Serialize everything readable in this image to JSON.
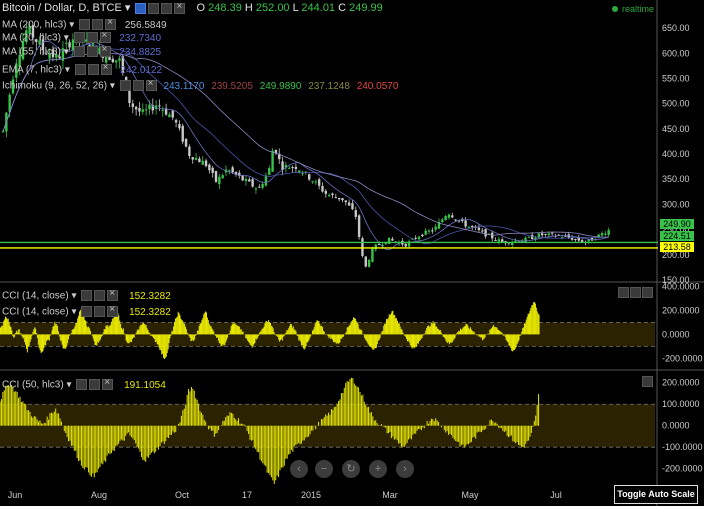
{
  "header": {
    "symbol": "Bitcoin / Dollar, D, BTCE",
    "ohlc": {
      "o_label": "O",
      "o": "248.39",
      "h_label": "H",
      "h": "252.00",
      "l_label": "L",
      "l": "244.01",
      "c_label": "C",
      "c": "249.99"
    },
    "realtime": "realtime"
  },
  "overlays": [
    {
      "label": "MA (200, hlc3)",
      "value": "256.5849",
      "color": "#c8c8c8"
    },
    {
      "label": "MA (20, hlc3)",
      "value": "232.7340",
      "color": "#5d6dd0"
    },
    {
      "label": "MA (55, hlc3)",
      "value": "234.8825",
      "color": "#5d6dd0"
    },
    {
      "label": "EMA (7, hlc3)",
      "value": "242.0122",
      "color": "#5d6dd0"
    },
    {
      "label": "Ichimoku (9, 26, 52, 26)",
      "values": [
        "243.1170",
        "239.5205",
        "249.9890",
        "237.1248",
        "240.0570"
      ],
      "colors": [
        "#4a8fe0",
        "#a04040",
        "#39c24a",
        "#8a8a40",
        "#e04a3a"
      ]
    }
  ],
  "indicators": [
    {
      "label": "CCI (14, close)",
      "value": "152.3282"
    },
    {
      "label": "CCI (14, close)",
      "value": "152.3282"
    },
    {
      "label": "CCI (50, hlc3)",
      "value": "191.1054"
    }
  ],
  "price_tags": [
    {
      "value": "249.90",
      "bg": "#39c24a"
    },
    {
      "value": "224.51",
      "bg": "#39c24a"
    },
    {
      "value": "213.58",
      "bg": "#ffff00"
    }
  ],
  "toggle_label": "Toggle Auto Scale",
  "colors": {
    "up": "#39c24a",
    "down": "#c8c8c8",
    "cci": "#e8e800",
    "hline_green": "#39c24a",
    "hline_yellow": "#ffff00",
    "band": "#2a2200"
  },
  "chart_data": {
    "type": "line",
    "main": {
      "ylim": [
        150,
        680
      ],
      "y_ticks": [
        150,
        200,
        250,
        300,
        350,
        400,
        450,
        500,
        550,
        600,
        650
      ],
      "tick_labels": [
        "150.00",
        "200.00",
        "250.00",
        "300.00",
        "350.00",
        "400.00",
        "450.00",
        "500.00",
        "550.00",
        "600.00",
        "650.00"
      ],
      "hlines": [
        224.51,
        213.58
      ],
      "x_labels": [
        "Jun",
        "Aug",
        "Oct",
        "17",
        "2015",
        "Mar",
        "May",
        "Jul"
      ],
      "close": [
        [
          "2014-05-20",
          445
        ],
        [
          "2014-05-28",
          580
        ],
        [
          "2014-06-05",
          650
        ],
        [
          "2014-06-15",
          610
        ],
        [
          "2014-06-25",
          590
        ],
        [
          "2014-07-05",
          630
        ],
        [
          "2014-07-15",
          620
        ],
        [
          "2014-07-25",
          600
        ],
        [
          "2014-08-05",
          585
        ],
        [
          "2014-08-12",
          500
        ],
        [
          "2014-08-20",
          480
        ],
        [
          "2014-08-30",
          500
        ],
        [
          "2014-09-10",
          470
        ],
        [
          "2014-09-20",
          400
        ],
        [
          "2014-10-01",
          380
        ],
        [
          "2014-10-08",
          345
        ],
        [
          "2014-10-15",
          370
        ],
        [
          "2014-10-25",
          350
        ],
        [
          "2014-11-05",
          330
        ],
        [
          "2014-11-12",
          370
        ],
        [
          "2014-11-15",
          420
        ],
        [
          "2014-11-20",
          375
        ],
        [
          "2014-11-30",
          375
        ],
        [
          "2014-12-10",
          350
        ],
        [
          "2014-12-20",
          320
        ],
        [
          "2014-12-31",
          310
        ],
        [
          "2015-01-08",
          280
        ],
        [
          "2015-01-14",
          170
        ],
        [
          "2015-01-20",
          215
        ],
        [
          "2015-01-30",
          230
        ],
        [
          "2015-02-10",
          220
        ],
        [
          "2015-02-20",
          240
        ],
        [
          "2015-03-01",
          250
        ],
        [
          "2015-03-10",
          285
        ],
        [
          "2015-03-20",
          262
        ],
        [
          "2015-04-01",
          245
        ],
        [
          "2015-04-15",
          225
        ],
        [
          "2015-04-30",
          230
        ],
        [
          "2015-05-10",
          240
        ],
        [
          "2015-05-25",
          237
        ],
        [
          "2015-06-10",
          225
        ],
        [
          "2015-06-20",
          242
        ],
        [
          "2015-06-25",
          249.99
        ]
      ]
    },
    "cci1": {
      "ylim": [
        -280,
        420
      ],
      "y_ticks": [
        -200,
        0,
        200,
        400
      ],
      "tick_labels": [
        "-200.0000",
        "0.0000",
        "200.0000",
        "400.0000"
      ],
      "bands": [
        -100,
        100
      ]
    },
    "cci2": {
      "ylim": [
        -290,
        250
      ],
      "y_ticks": [
        -200,
        -100,
        0,
        100,
        200
      ],
      "tick_labels": [
        "-200.0000",
        "-100.0000",
        "0.0000",
        "100.0000",
        "200.0000"
      ],
      "bands": [
        -100,
        100
      ]
    },
    "cci14": [
      60,
      80,
      160,
      120,
      60,
      -40,
      20,
      40,
      -20,
      -60,
      -140,
      -60,
      20,
      60,
      -80,
      -160,
      -120,
      -60,
      -40,
      40,
      100,
      60,
      -40,
      -120,
      -120,
      -40,
      20,
      60,
      100,
      180,
      220,
      120,
      60,
      40,
      -40,
      -100,
      -60,
      -20,
      40,
      80,
      60,
      120,
      160,
      180,
      80,
      40,
      -40,
      -80,
      -60,
      -20,
      20,
      60,
      100,
      80,
      40,
      0,
      -40,
      -60,
      -100,
      -160,
      -200,
      -160,
      -40,
      40,
      120,
      180,
      140,
      100,
      40,
      -20,
      -60,
      -40,
      20,
      80,
      140,
      200,
      120,
      60,
      20,
      -20,
      -60,
      -100,
      -80,
      -20,
      40,
      100,
      80,
      60,
      40,
      0,
      -40,
      -80,
      -100,
      -60,
      -20,
      20,
      60,
      100,
      120,
      80,
      20,
      -20,
      -60,
      -40,
      0,
      40,
      80,
      60,
      20,
      -40,
      -80,
      -120,
      -80,
      -40,
      20,
      80,
      120,
      80,
      40,
      0,
      -20,
      -40,
      -60,
      -80,
      -60,
      -20,
      20,
      60,
      100,
      140,
      120,
      60,
      20,
      -20,
      -60,
      -100,
      -140,
      -120,
      -60,
      0,
      60,
      120,
      160,
      200,
      160,
      120,
      60,
      20,
      -20,
      -60,
      -100,
      -120,
      -100,
      -60,
      -20,
      20,
      60,
      80,
      100,
      80,
      40,
      20,
      -20,
      -60,
      -80,
      -60,
      -20,
      20,
      40,
      60,
      80,
      60,
      40,
      20,
      0,
      -20,
      -40,
      -20,
      0,
      40,
      80,
      60,
      40,
      20,
      -20,
      -60,
      -100,
      -140,
      -120,
      -60,
      0,
      60,
      120,
      180,
      240,
      280,
      200,
      152
    ],
    "cci50": [
      120,
      160,
      200,
      180,
      150,
      120,
      90,
      60,
      40,
      20,
      10,
      30,
      60,
      80,
      40,
      -20,
      -60,
      -100,
      -140,
      -180,
      -200,
      -220,
      -240,
      -200,
      -180,
      -150,
      -120,
      -100,
      -80,
      -60,
      -40,
      -60,
      -100,
      -140,
      -160,
      -140,
      -120,
      -100,
      -80,
      -60,
      -40,
      -20,
      20,
      80,
      160,
      180,
      120,
      60,
      20,
      -20,
      -40,
      -20,
      20,
      40,
      60,
      40,
      20,
      0,
      -40,
      -80,
      -120,
      -160,
      -200,
      -240,
      -270,
      -230,
      -190,
      -150,
      -120,
      -100,
      -80,
      -60,
      -40,
      -20,
      0,
      20,
      40,
      60,
      80,
      120,
      160,
      200,
      220,
      200,
      160,
      120,
      80,
      40,
      20,
      0,
      -20,
      -40,
      -60,
      -80,
      -100,
      -80,
      -60,
      -40,
      -20,
      0,
      20,
      40,
      20,
      0,
      -20,
      -40,
      -60,
      -80,
      -100,
      -90,
      -70,
      -50,
      -30,
      -10,
      10,
      30,
      10,
      -10,
      -30,
      -50,
      -70,
      -90,
      -100,
      -80,
      -40,
      40,
      191
    ]
  }
}
